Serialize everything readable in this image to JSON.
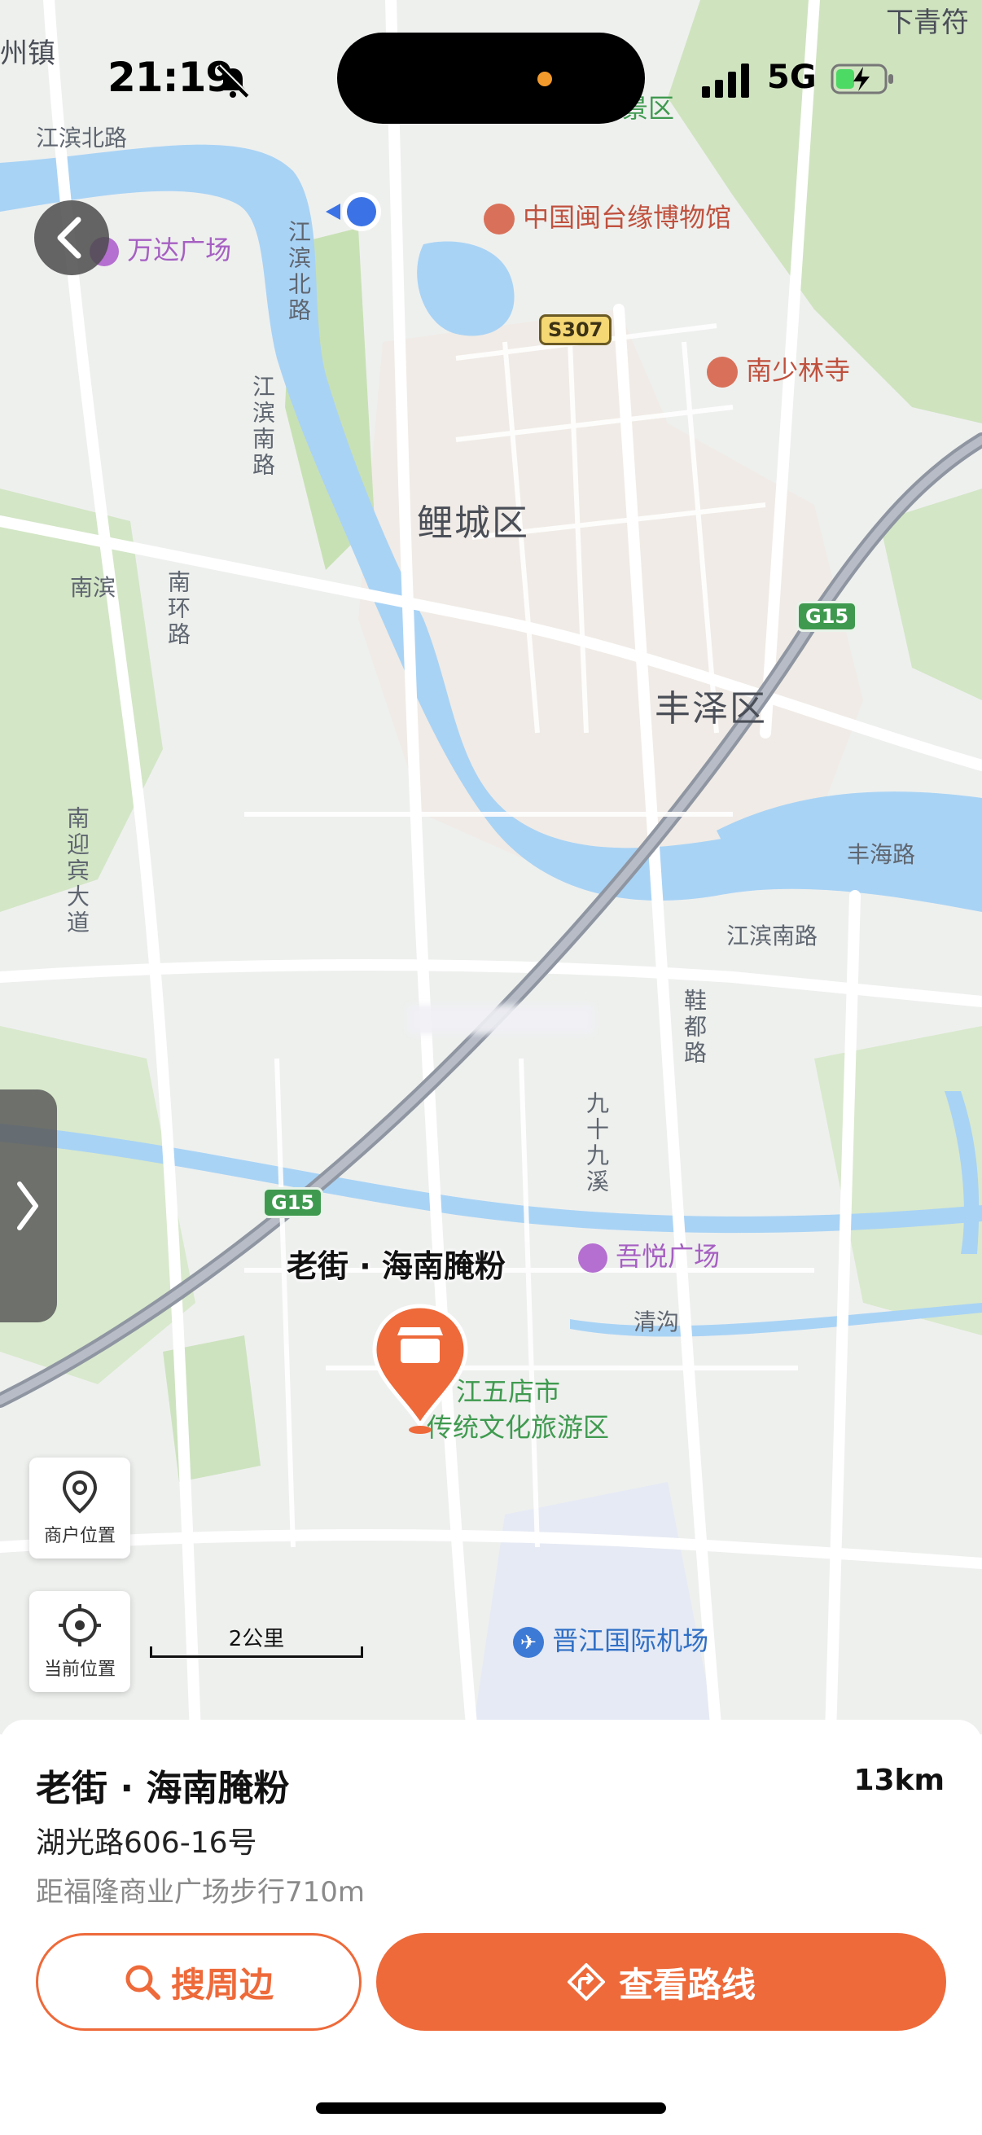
{
  "status_bar": {
    "time": "21:19",
    "network": "5G"
  },
  "map": {
    "districts": [
      "鲤城区",
      "丰泽区"
    ],
    "roads": {
      "jiangbin_north_h": "江滨北路",
      "jiangbin_north_v": "江滨北路",
      "jiangbin_south_v": "江滨南路",
      "huanhuan": "南环路",
      "nanxun": "南滨",
      "nanxun_dadao": "南迎宾大道",
      "jiangbin_south_h": "江滨南路",
      "fenghai": "丰海路",
      "xiedu": "鞋都路",
      "jiushijiu": "九十九溪",
      "qinggou": "清沟"
    },
    "pois": {
      "wanda": "万达广场",
      "museum": "中国闽台缘博物馆",
      "shaolin": "南少林寺",
      "scenic_area": "景区",
      "wuyue": "吾悦广场",
      "wudianshi_1": "江五店市",
      "wudianshi_2": "传统文化旅游区",
      "airport": "晋江国际机场",
      "top_left": "州镇",
      "top_right": "下青符"
    },
    "shields": {
      "s307": "S307",
      "g15_a": "G15",
      "g15_b": "G15"
    },
    "shop_pin_label": "老街 · 海南腌粉",
    "scale_label": "2公里",
    "controls": {
      "merchant_location": "商户位置",
      "current_location": "当前位置"
    }
  },
  "sheet": {
    "shop_name": "老街 · 海南腌粉",
    "distance": "13km",
    "address": "湖光路606-16号",
    "nearby": "距福隆商业广场步行710m",
    "search_button": "搜周边",
    "route_button": "查看路线"
  },
  "colors": {
    "accent": "#ee6a3a",
    "water": "#a9d3f5",
    "park": "#cfe6c4"
  }
}
